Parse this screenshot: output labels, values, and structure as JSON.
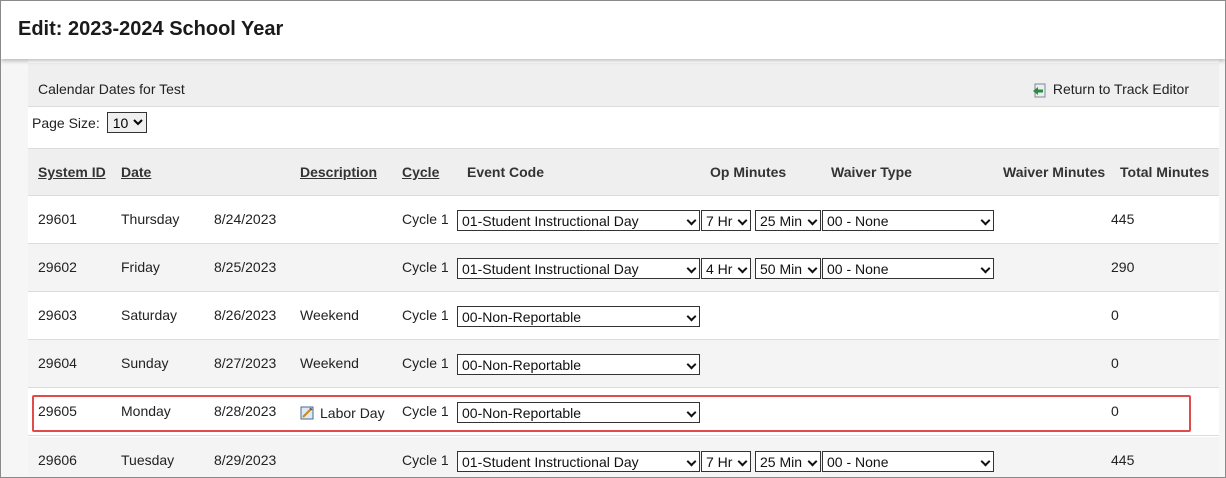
{
  "header": {
    "title": "Edit: 2023-2024 School Year"
  },
  "panel": {
    "title": "Calendar Dates for Test",
    "return_label": "Return to Track Editor",
    "page_size_label": "Page Size:",
    "page_size_value": "10"
  },
  "columns": {
    "system_id": "System ID",
    "date": "Date",
    "description": "Description",
    "cycle": "Cycle",
    "event_code": "Event Code",
    "op_minutes": "Op Minutes",
    "waiver_type": "Waiver Type",
    "waiver_minutes": "Waiver Minutes",
    "total_minutes": "Total Minutes"
  },
  "rows": [
    {
      "id": "29601",
      "day": "Thursday",
      "date": "8/24/2023",
      "description": "",
      "cycle": "Cycle 1",
      "event": "01-Student Instructional Day",
      "hours": "7 Hr",
      "mins": "25 Min",
      "waiver": "00 - None",
      "total": "445"
    },
    {
      "id": "29602",
      "day": "Friday",
      "date": "8/25/2023",
      "description": "",
      "cycle": "Cycle 1",
      "event": "01-Student Instructional Day",
      "hours": "4 Hr",
      "mins": "50 Min",
      "waiver": "00 - None",
      "total": "290"
    },
    {
      "id": "29603",
      "day": "Saturday",
      "date": "8/26/2023",
      "description": "Weekend",
      "cycle": "Cycle 1",
      "event": "00-Non-Reportable",
      "total": "0"
    },
    {
      "id": "29604",
      "day": "Sunday",
      "date": "8/27/2023",
      "description": "Weekend",
      "cycle": "Cycle 1",
      "event": "00-Non-Reportable",
      "total": "0"
    },
    {
      "id": "29605",
      "day": "Monday",
      "date": "8/28/2023",
      "description": "Labor Day",
      "cycle": "Cycle 1",
      "event": "00-Non-Reportable",
      "total": "0"
    },
    {
      "id": "29606",
      "day": "Tuesday",
      "date": "8/29/2023",
      "description": "",
      "cycle": "Cycle 1",
      "event": "01-Student Instructional Day",
      "hours": "7 Hr",
      "mins": "25 Min",
      "waiver": "00 - None",
      "total": "445"
    }
  ],
  "icons": {
    "return": "return-arrow-icon",
    "holiday": "calendar-note-icon",
    "dropdown": "chevron-down-icon"
  },
  "colors": {
    "highlight": "#e04b4b",
    "return_icon": "#2e8b3a"
  }
}
